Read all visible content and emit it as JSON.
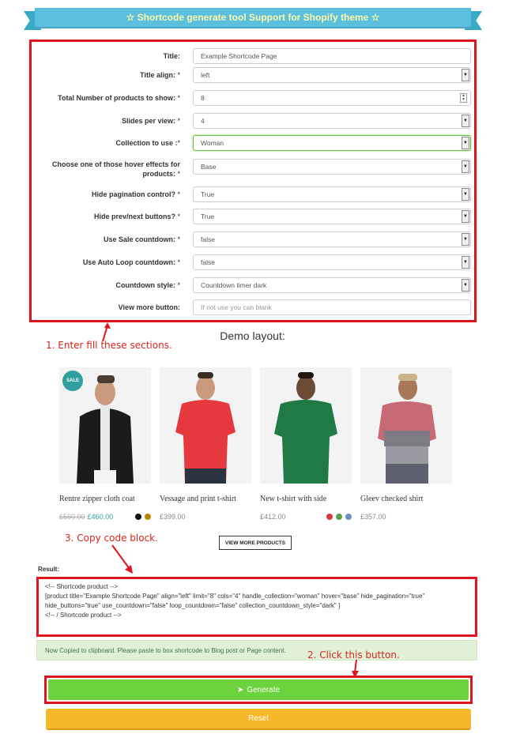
{
  "header": {
    "title": "☆ Shortcode generate tool Support for Shopify theme ☆"
  },
  "form": {
    "fields": [
      {
        "label": "Title:",
        "required": false,
        "value": "Example Shortcode Page",
        "type": "text"
      },
      {
        "label": "Title align:",
        "required": true,
        "value": "left",
        "type": "select"
      },
      {
        "label": "Total Number of products to show:",
        "required": true,
        "value": "8",
        "type": "number"
      },
      {
        "label": "Slides per view:",
        "required": true,
        "value": "4",
        "type": "select"
      },
      {
        "label": "Collection to use :",
        "required": true,
        "value": "Woman",
        "type": "select"
      },
      {
        "label": "Choose one of those hover effects for products:",
        "required": true,
        "value": "Base",
        "type": "select"
      },
      {
        "label": "Hide pagination control?",
        "required": true,
        "value": "True",
        "type": "select"
      },
      {
        "label": "Hide prev/next buttons?",
        "required": true,
        "value": "True",
        "type": "select"
      },
      {
        "label": "Use Sale countdown:",
        "required": true,
        "value": "false",
        "type": "select"
      },
      {
        "label": "Use Auto Loop countdown:",
        "required": true,
        "value": "false",
        "type": "select"
      },
      {
        "label": "Countdown style:",
        "required": true,
        "value": "Countdown timer dark",
        "type": "select"
      },
      {
        "label": "View more button:",
        "required": false,
        "value": "",
        "placeholder": "If not use you can blank",
        "type": "text"
      }
    ],
    "required_mark": "*"
  },
  "annotations": {
    "step1": "1. Enter fill these sections.",
    "step2": "2. Click this button.",
    "step3": "3. Copy code block."
  },
  "demo": {
    "title": "Demo layout:",
    "products": [
      {
        "name": "Rentre zipper cloth coat",
        "old_price": "£560.00",
        "price": "£460.00",
        "sale": true,
        "badge": "SALE",
        "swatches": [
          "#111111",
          "#b8860b"
        ]
      },
      {
        "name": "Vessage and print t-shirt",
        "old_price": "",
        "price": "£399.00",
        "sale": false,
        "swatches": []
      },
      {
        "name": "New t-shirt with side",
        "old_price": "",
        "price": "£412.00",
        "sale": false,
        "swatches": [
          "#d9363e",
          "#5a9e4b",
          "#6b8fc2"
        ]
      },
      {
        "name": "Gleev checked shirt",
        "old_price": "",
        "price": "£357.00",
        "sale": false,
        "swatches": []
      }
    ],
    "view_more": "VIEW MORE PRODUCTS"
  },
  "result": {
    "label": "Result:",
    "lines": [
      "<!-- Shortcode product -->",
      "[product title=\"Example Shortcode Page\" align=\"left\" limit=\"8\" cols=\"4\" handle_collection=\"woman\" hover=\"base\" hide_pagination=\"true\"",
      "hide_buttons=\"true\" use_countdown=\"false\" loop_countdown=\"false\" collection_countdown_style=\"dark\" ]",
      " <!-- / Shortcode product -->"
    ]
  },
  "notice": "Now Copied to clipboard. Please paste to box shortcode to Blog post or Page content.",
  "buttons": {
    "generate": "Generate",
    "reset": "Reset"
  },
  "colors": {
    "ribbon": "#5bc0de",
    "highlight": "#e0141d",
    "generate": "#6cd23d",
    "reset": "#f5b82a",
    "accent": "#2f9fa0"
  }
}
